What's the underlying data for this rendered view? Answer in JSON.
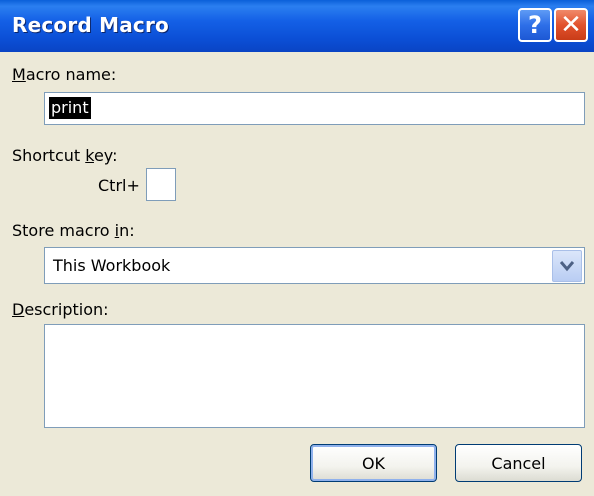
{
  "window": {
    "title": "Record Macro",
    "help_glyph": "?",
    "close_glyph": "✕"
  },
  "form": {
    "macro_name_label": "Macro name:",
    "macro_name_value": "print",
    "shortcut_label": "Shortcut key:",
    "ctrl_prefix": "Ctrl+",
    "shortcut_value": "",
    "store_label": "Store macro in:",
    "store_value": "This Workbook",
    "description_label": "Description:",
    "description_value": ""
  },
  "buttons": {
    "ok": "OK",
    "cancel": "Cancel"
  },
  "colors": {
    "titlebar": "#0b4fd6",
    "dialog_bg": "#ece9d8",
    "close": "#e2522d"
  },
  "icons": {
    "help": "help-icon",
    "close": "close-icon",
    "dropdown": "chevron-down-icon"
  }
}
